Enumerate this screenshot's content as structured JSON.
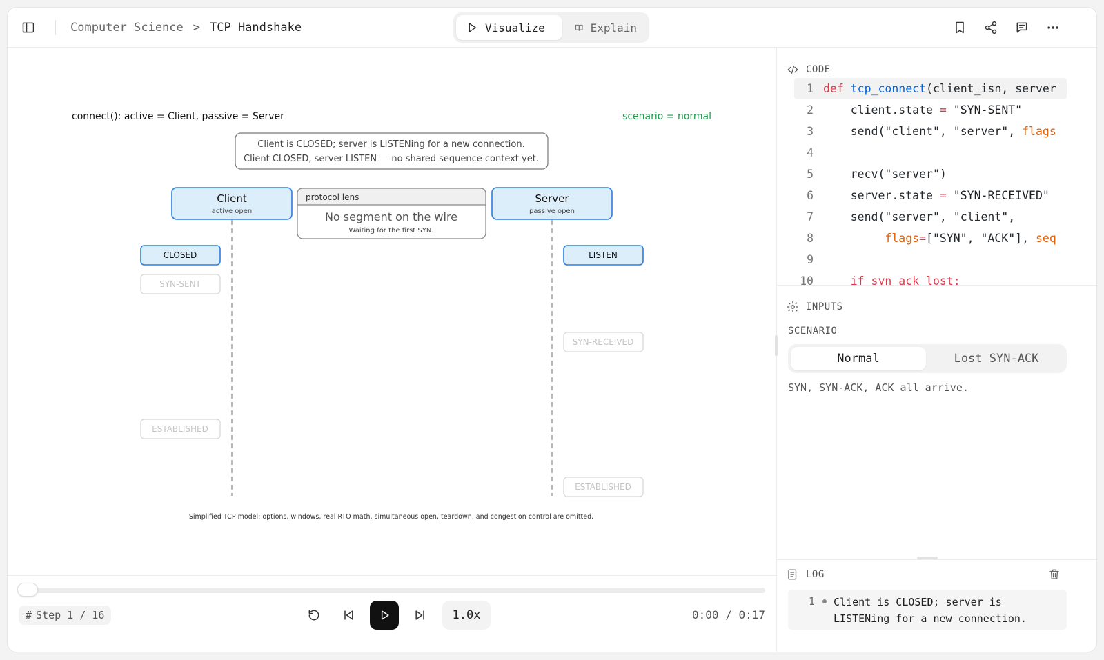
{
  "header": {
    "breadcrumb_parent": "Computer Science",
    "breadcrumb_separator": ">",
    "breadcrumb_current": "TCP Handshake",
    "mode_visualize": "Visualize",
    "mode_explain": "Explain"
  },
  "canvas": {
    "connect_label": "connect():  active = Client,  passive = Server",
    "scenario_label": "scenario = normal",
    "info_line1": "Client is CLOSED; server is LISTENing for a new connection.",
    "info_line2": "Client CLOSED, server LISTEN — no shared sequence context yet.",
    "client_title": "Client",
    "client_sub": "active open",
    "server_title": "Server",
    "server_sub": "passive open",
    "lens_label": "protocol lens",
    "lens_main": "No segment on the wire",
    "lens_sub": "Waiting for the first SYN.",
    "client_states": {
      "closed": "CLOSED",
      "syn_sent": "SYN-SENT",
      "established": "ESTABLISHED"
    },
    "server_states": {
      "listen": "LISTEN",
      "syn_received": "SYN-RECEIVED",
      "established": "ESTABLISHED"
    },
    "footnote": "Simplified TCP model: options, windows, real RTO math, simultaneous open, teardown, and congestion control are omitted."
  },
  "playback": {
    "step_hash": "#",
    "step_text": "Step 1 / 16",
    "speed": "1.0x",
    "time": "0:00 / 0:17",
    "progress": 0
  },
  "panel": {
    "code_title": "CODE",
    "code_lines": [
      {
        "n": "1"
      },
      {
        "n": "2"
      },
      {
        "n": "3"
      },
      {
        "n": "4"
      },
      {
        "n": "5"
      },
      {
        "n": "6"
      },
      {
        "n": "7"
      },
      {
        "n": "8"
      },
      {
        "n": "9"
      },
      {
        "n": "10"
      }
    ],
    "code": {
      "l1_kw": "def",
      "l1_fn": "tcp_connect",
      "l1_rest": "(client_isn, server",
      "l2_a": "client.state",
      "l2_op": "=",
      "l2_str": "\"SYN-SENT\"",
      "l3_a": "send(\"client\", \"server\", ",
      "l3_b": "flags",
      "l5": "recv(\"server\")",
      "l6_a": "server.state",
      "l6_op": "=",
      "l6_str": "\"SYN-RECEIVED\"",
      "l7": "send(\"server\", \"client\",",
      "l8_a": "flags",
      "l8_op": "=",
      "l8_b": "[\"SYN\", \"ACK\"], ",
      "l8_c": "seq",
      "l10": "if syn_ack_lost:"
    },
    "inputs_title": "INPUTS",
    "scenario_label": "SCENARIO",
    "scenario_options": [
      "Normal",
      "Lost SYN-ACK"
    ],
    "scenario_desc": "SYN, SYN-ACK, ACK all arrive.",
    "log_title": "LOG",
    "log_entries": [
      {
        "n": "1",
        "text": "Client is CLOSED; server is LISTENing for a new connection."
      }
    ]
  },
  "colors": {
    "active_fill": "#ddeefb",
    "active_stroke": "#2a7de1",
    "scenario_green": "#1e9a4a"
  }
}
